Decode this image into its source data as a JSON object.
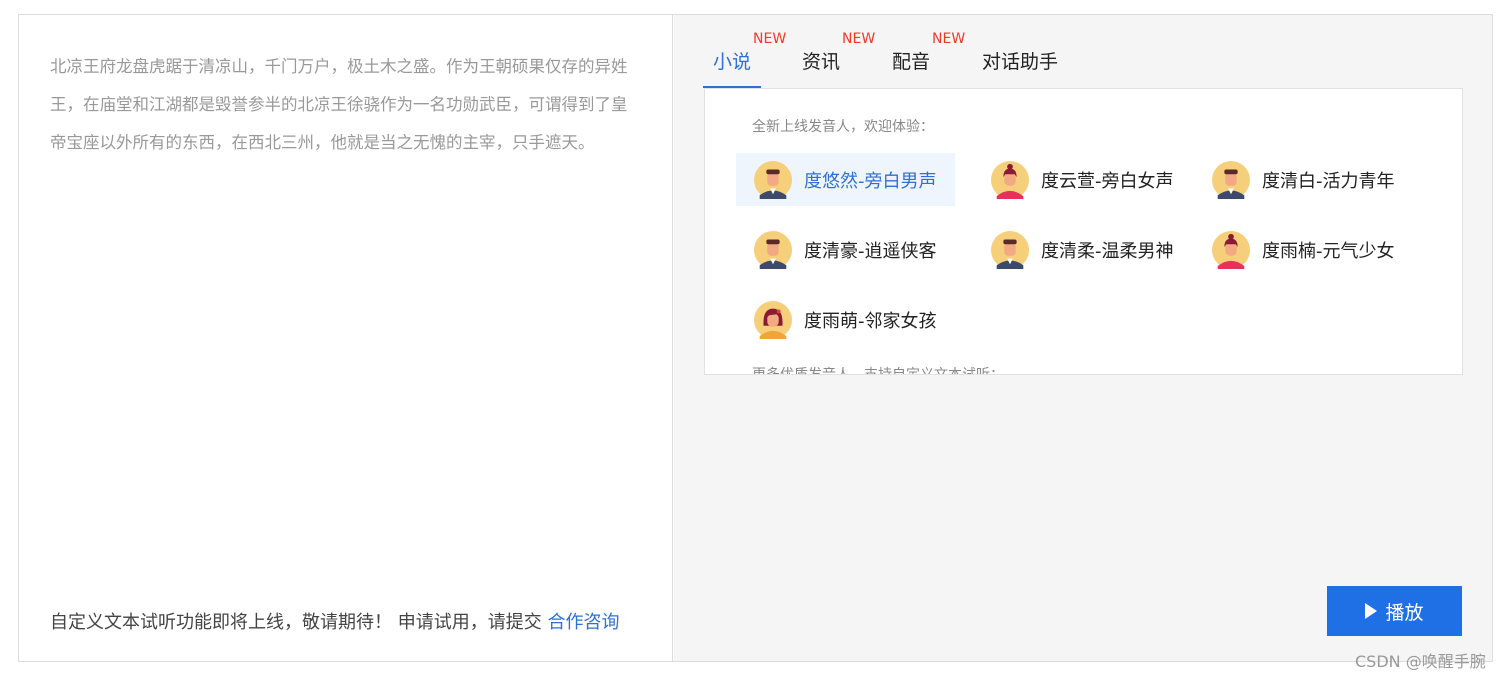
{
  "left": {
    "sample_text": "北凉王府龙盘虎踞于清凉山，千门万户，极土木之盛。作为王朝硕果仅存的异姓王，在庙堂和江湖都是毁誉参半的北凉王徐骁作为一名功勋武臣，可谓得到了皇帝宝座以外所有的东西，在西北三州，他就是当之无愧的主宰，只手遮天。",
    "footer_note": "自定义文本试听功能即将上线，敬请期待！ 申请试用，请提交 ",
    "footer_link": "合作咨询"
  },
  "tabs": [
    {
      "label": "小说",
      "badge": "NEW",
      "active": true
    },
    {
      "label": "资讯",
      "badge": "NEW",
      "active": false
    },
    {
      "label": "配音",
      "badge": "NEW",
      "active": false
    },
    {
      "label": "对话助手",
      "badge": "",
      "active": false
    }
  ],
  "voice_panel": {
    "hint": "全新上线发音人，欢迎体验：",
    "hint_more": "更多优质发音人，支持自定义文本试听：",
    "voices": [
      {
        "name": "度悠然-旁白男声",
        "avatar": "male-avatar-icon",
        "selected": true
      },
      {
        "name": "度云萱-旁白女声",
        "avatar": "female-avatar-icon",
        "selected": false
      },
      {
        "name": "度清白-活力青年",
        "avatar": "male-avatar-icon",
        "selected": false
      },
      {
        "name": "度清豪-逍遥侠客",
        "avatar": "male-avatar-icon",
        "selected": false
      },
      {
        "name": "度清柔-温柔男神",
        "avatar": "male-avatar-icon",
        "selected": false
      },
      {
        "name": "度雨楠-元气少女",
        "avatar": "female-avatar-icon",
        "selected": false
      },
      {
        "name": "度雨萌-邻家女孩",
        "avatar": "girl-avatar-icon",
        "selected": false
      }
    ]
  },
  "play_button": {
    "label": "播放",
    "color": "#1f6fe5"
  },
  "accent_color": "#2f6fd6",
  "badge_color": "#ef3b2c",
  "watermark": "CSDN @唤醒手腕"
}
